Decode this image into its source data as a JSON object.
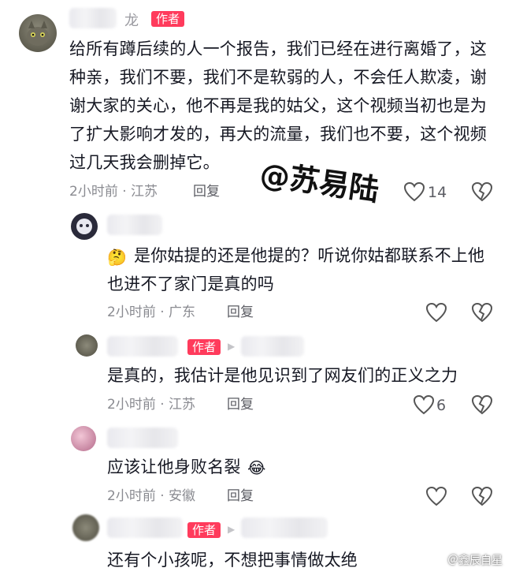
{
  "comments": [
    {
      "name_fragment": "龙",
      "author_tag": "作者",
      "text": "给所有蹲后续的人一个报告，我们已经在进行离婚了，这种亲，我们不要，我们不是软弱的人，不会任人欺凌，谢谢大家的关心，他不再是我的姑父，这个视频当初也是为了扩大影响才发的，再大的流量，我们也不要，这个视频过几天我会删掉它。",
      "time": "2小时前 · 江苏",
      "reply": "回复",
      "likes": "14"
    },
    {
      "text": "是你姑提的还是他提的？听说你姑都联系不上他 也进不了家门是真的吗",
      "time": "2小时前 · 广东",
      "reply": "回复"
    },
    {
      "author_tag": "作者",
      "text": "是真的，我估计是他见识到了网友们的正义之力",
      "time": "2小时前 · 江苏",
      "reply": "回复",
      "likes": "6"
    },
    {
      "text": "应该让他身败名裂",
      "time": "2小时前 · 安徽",
      "reply": "回复"
    },
    {
      "author_tag": "作者",
      "text": "还有个小孩呢，不想把事情做太绝"
    }
  ],
  "watermark": "@苏易陆",
  "footer_mark": "＠鑫辰自星",
  "icons": {
    "heart": "heart-outline-icon",
    "dislike": "broken-heart-icon",
    "emoji_think": "thinking-face-emoji",
    "emoji_laugh": "laughing-face-emoji",
    "arrow": "play-arrow-icon"
  }
}
